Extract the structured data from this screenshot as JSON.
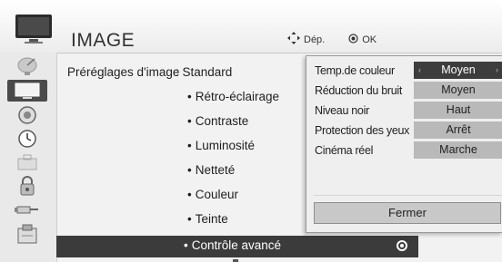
{
  "header": {
    "title": "IMAGE",
    "move_hint": "Dép.",
    "ok_hint": "OK",
    "icon": "tv-icon"
  },
  "sidebar": {
    "items": [
      {
        "icon": "satellite-dish-icon"
      },
      {
        "icon": "picture-icon",
        "active": true
      },
      {
        "icon": "speaker-icon"
      },
      {
        "icon": "clock-icon"
      },
      {
        "icon": "lock-icon"
      },
      {
        "icon": "padlock-icon"
      },
      {
        "icon": "input-cable-icon"
      },
      {
        "icon": "usb-media-icon"
      }
    ]
  },
  "main": {
    "preset_label": "Préréglages d'image",
    "preset_value": ": Standard",
    "items": [
      "Rétro-éclairage",
      "Contraste",
      "Luminosité",
      "Netteté",
      "Couleur",
      "Teinte"
    ],
    "selected_item": "Contrôle avancé"
  },
  "popup": {
    "rows": [
      {
        "label": "Temp.de couleur",
        "value": "Moyen",
        "selected": true
      },
      {
        "label": "Réduction du bruit",
        "value": "Moyen"
      },
      {
        "label": "Niveau noir",
        "value": "Haut"
      },
      {
        "label": "Protection des yeux",
        "value": "Arrêt"
      },
      {
        "label": "Cinéma réel",
        "value": "Marche"
      }
    ],
    "close_label": "Fermer",
    "arrow_left": "‹",
    "arrow_right": "›"
  },
  "colors": {
    "highlight": "#3b3b3b",
    "value_bg": "#b9b9b9",
    "selected_value_bg": "#3d3d3d"
  }
}
